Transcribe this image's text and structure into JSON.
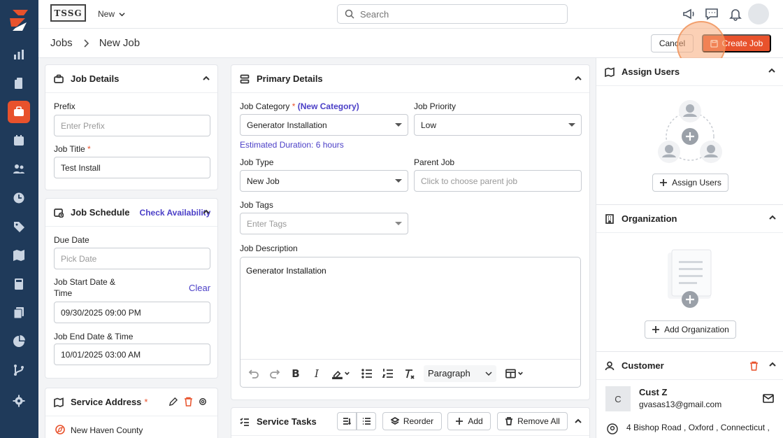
{
  "topbar": {
    "brand": "TSSG",
    "new_label": "New",
    "search_placeholder": "Search"
  },
  "header": {
    "crumb_root": "Jobs",
    "crumb_current": "New Job",
    "cancel_label": "Cancel",
    "create_label": "Create Job"
  },
  "job_details": {
    "title": "Job Details",
    "prefix_label": "Prefix",
    "prefix_placeholder": "Enter Prefix",
    "job_title_label": "Job Title",
    "job_title_value": "Test Install"
  },
  "job_schedule": {
    "title": "Job Schedule",
    "check_availability": "Check Availability",
    "due_date_label": "Due Date",
    "due_date_placeholder": "Pick Date",
    "start_label_1": "Job Start Date &",
    "start_label_2": "Time",
    "clear_label": "Clear",
    "start_value": "09/30/2025 09:00 PM",
    "end_label": "Job End Date & Time",
    "end_value": "10/01/2025 03:00 AM"
  },
  "service_address": {
    "title": "Service Address",
    "line1": "New Haven County"
  },
  "primary_details": {
    "title": "Primary Details",
    "category_label": "Job Category",
    "new_category": "(New Category)",
    "category_value": "Generator Installation",
    "estimated_duration": "Estimated Duration: 6 hours",
    "priority_label": "Job Priority",
    "priority_value": "Low",
    "type_label": "Job Type",
    "type_value": "New Job",
    "parent_label": "Parent Job",
    "parent_placeholder": "Click to choose parent job",
    "tags_label": "Job Tags",
    "tags_placeholder": "Enter Tags",
    "description_label": "Job Description",
    "description_value": "Generator Installation",
    "paragraph_option": "Paragraph"
  },
  "service_tasks": {
    "title": "Service Tasks",
    "reorder_label": "Reorder",
    "add_label": "Add",
    "remove_all_label": "Remove All"
  },
  "assign_users": {
    "title": "Assign Users",
    "button_label": "Assign Users"
  },
  "organization": {
    "title": "Organization",
    "button_label": "Add Organization"
  },
  "customer": {
    "title": "Customer",
    "initial": "C",
    "name": "Cust Z",
    "email": "gvasas13@gmail.com",
    "address": "4 Bishop Road , Oxford , Connecticut ,"
  },
  "colors": {
    "accent": "#e8522c",
    "sidebar": "#1f3a5a",
    "link": "#4b3fc7"
  }
}
